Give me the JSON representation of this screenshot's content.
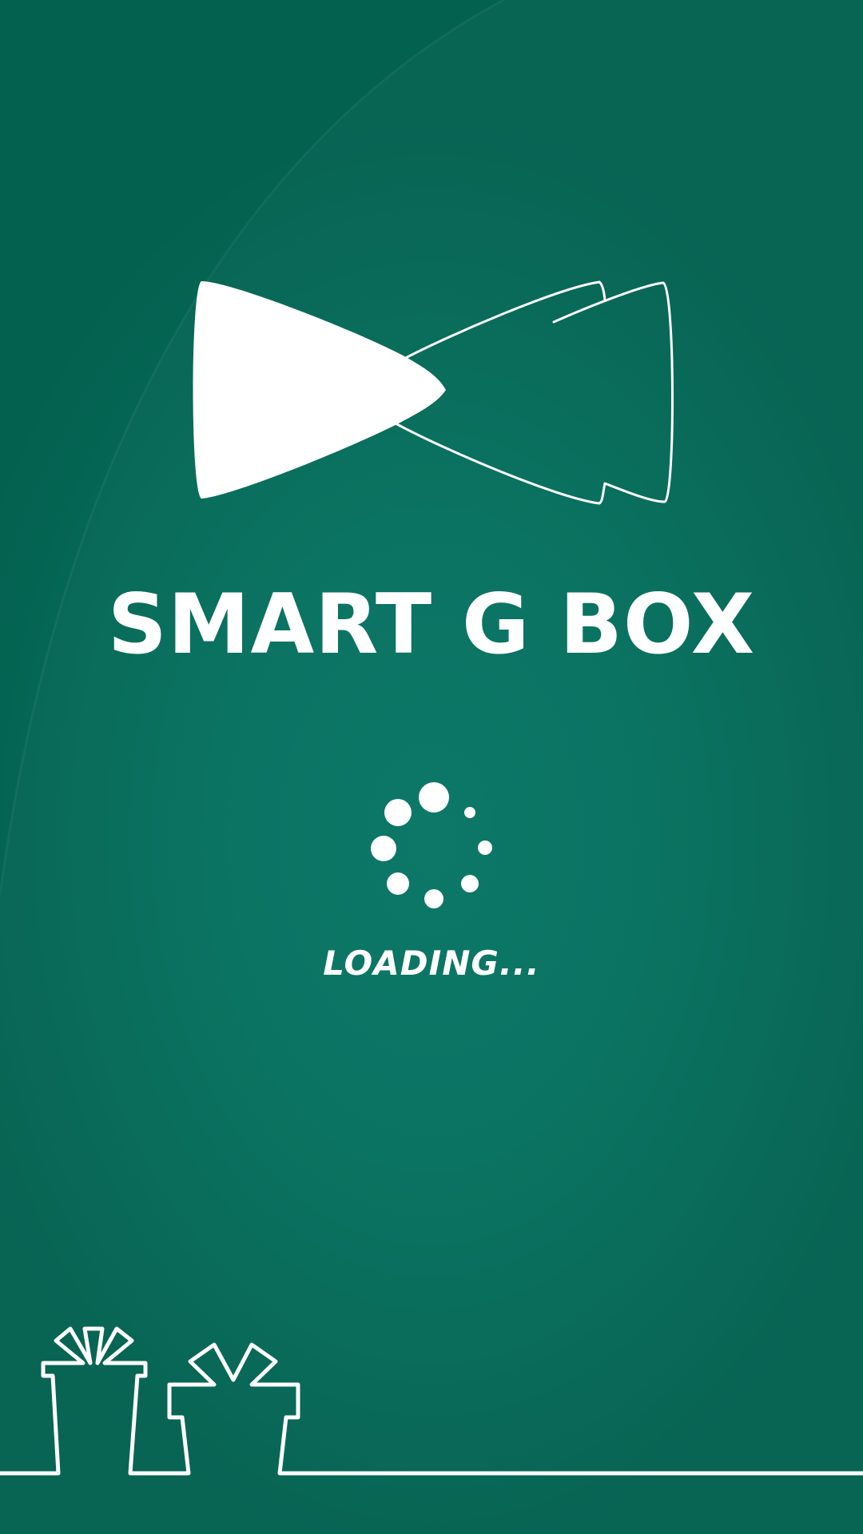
{
  "splash": {
    "app_name": "SMART G BOX",
    "loading_label": "LOADING...",
    "logo_icon": "bow-tie-logo-icon",
    "spinner_icon": "loading-spinner-icon",
    "footer_icon": "gift-boxes-outline-icon"
  },
  "colors": {
    "background": "#06705f",
    "foreground": "#ffffff"
  }
}
